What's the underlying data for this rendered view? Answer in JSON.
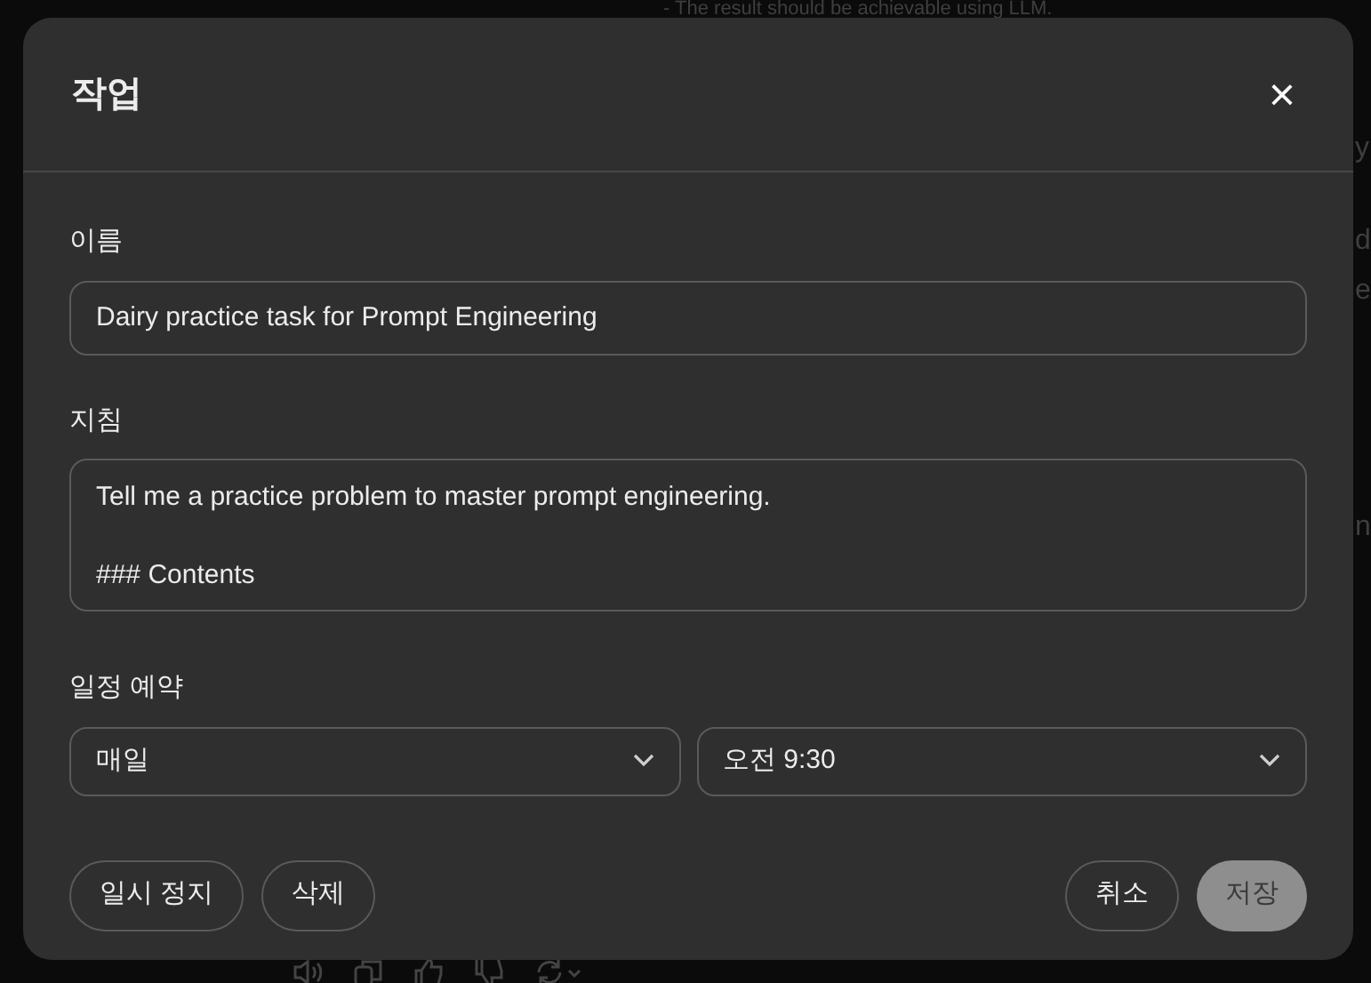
{
  "background": {
    "line": "- The result should be achievable using LLM.",
    "fragments": [
      "y",
      "d",
      "e",
      "n"
    ]
  },
  "dialog": {
    "title": "작업",
    "close": "×",
    "name": {
      "label": "이름",
      "value": "Dairy practice task for Prompt Engineering"
    },
    "instructions": {
      "label": "지침",
      "value": "Tell me a practice problem to master prompt engineering.\n\n### Contents"
    },
    "schedule": {
      "label": "일정 예약",
      "frequency": "매일",
      "time": "오전 9:30"
    },
    "buttons": [
      {
        "label": "일시 정지",
        "kind": "outline",
        "disabled": false
      },
      {
        "label": "삭제",
        "kind": "outline",
        "disabled": false
      },
      {
        "label": "취소",
        "kind": "outline",
        "disabled": false
      },
      {
        "label": "저장",
        "kind": "primary",
        "disabled": true
      }
    ]
  }
}
